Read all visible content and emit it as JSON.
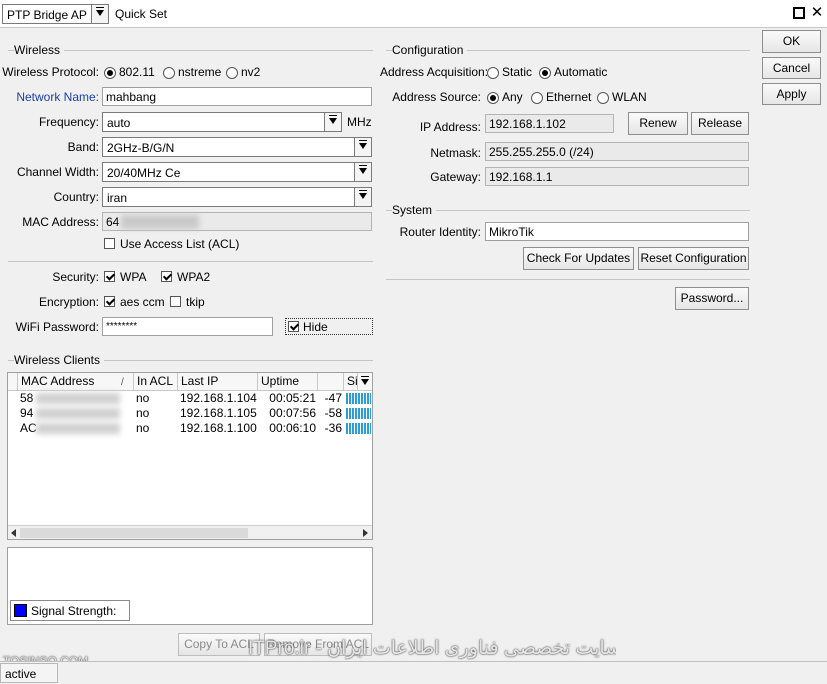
{
  "titlebar": {
    "mode_value": "PTP Bridge AP",
    "title": "Quick Set"
  },
  "dialog_buttons": {
    "ok": "OK",
    "cancel": "Cancel",
    "apply": "Apply"
  },
  "wireless": {
    "group_title": "Wireless",
    "protocol_label": "Wireless Protocol:",
    "protocol_options": [
      "802.11",
      "nstreme",
      "nv2"
    ],
    "protocol_selected": "802.11",
    "network_name_label": "Network Name:",
    "network_name_value": "mahbang",
    "frequency_label": "Frequency:",
    "frequency_value": "auto",
    "frequency_unit": "MHz",
    "band_label": "Band:",
    "band_value": "2GHz-B/G/N",
    "channel_width_label": "Channel Width:",
    "channel_width_value": "20/40MHz Ce",
    "country_label": "Country:",
    "country_value": "iran",
    "mac_label": "MAC Address:",
    "mac_value": "64",
    "use_acl_label": "Use Access List (ACL)",
    "security_label": "Security:",
    "wpa_label": "WPA",
    "wpa2_label": "WPA2",
    "encryption_label": "Encryption:",
    "aes_label": "aes ccm",
    "tkip_label": "tkip",
    "password_label": "WiFi Password:",
    "password_value": "********",
    "hide_label": "Hide"
  },
  "clients": {
    "group_title": "Wireless Clients",
    "columns": [
      "MAC Address",
      "In ACL",
      "Last IP",
      "Uptime",
      "Sig"
    ],
    "rows": [
      {
        "mac": "58",
        "acl": "no",
        "ip": "192.168.1.104",
        "uptime": "00:05:21",
        "signal": "-47",
        "strength": 0.95
      },
      {
        "mac": "94",
        "acl": "no",
        "ip": "192.168.1.105",
        "uptime": "00:07:56",
        "signal": "-58",
        "strength": 0.95
      },
      {
        "mac": "AC",
        "acl": "no",
        "ip": "192.168.1.100",
        "uptime": "00:06:10",
        "signal": "-36",
        "strength": 0.95
      }
    ],
    "legend_label": "Signal Strength:",
    "legend_color": "#0000ff",
    "copy_to_acl": "Copy To ACL",
    "remove_from_acl": "Remove From ACL"
  },
  "configuration": {
    "group_title": "Configuration",
    "acq_label": "Address Acquisition:",
    "acq_options": [
      "Static",
      "Automatic"
    ],
    "acq_selected": "Automatic",
    "source_label": "Address Source:",
    "source_options": [
      "Any",
      "Ethernet",
      "WLAN"
    ],
    "source_selected": "Any",
    "ip_label": "IP Address:",
    "ip_value": "192.168.1.102",
    "renew": "Renew",
    "release": "Release",
    "netmask_label": "Netmask:",
    "netmask_value": "255.255.255.0 (/24)",
    "gateway_label": "Gateway:",
    "gateway_value": "192.168.1.1"
  },
  "system": {
    "group_title": "System",
    "identity_label": "Router Identity:",
    "identity_value": "MikroTik",
    "check_updates": "Check For Updates",
    "reset_config": "Reset Configuration",
    "password": "Password..."
  },
  "watermarks": {
    "left": "TOSINSO.COM",
    "right": "ITPro.ir - وب سایت تخصصی فناوری اطلاعات ایران"
  },
  "status": {
    "text": "active"
  }
}
